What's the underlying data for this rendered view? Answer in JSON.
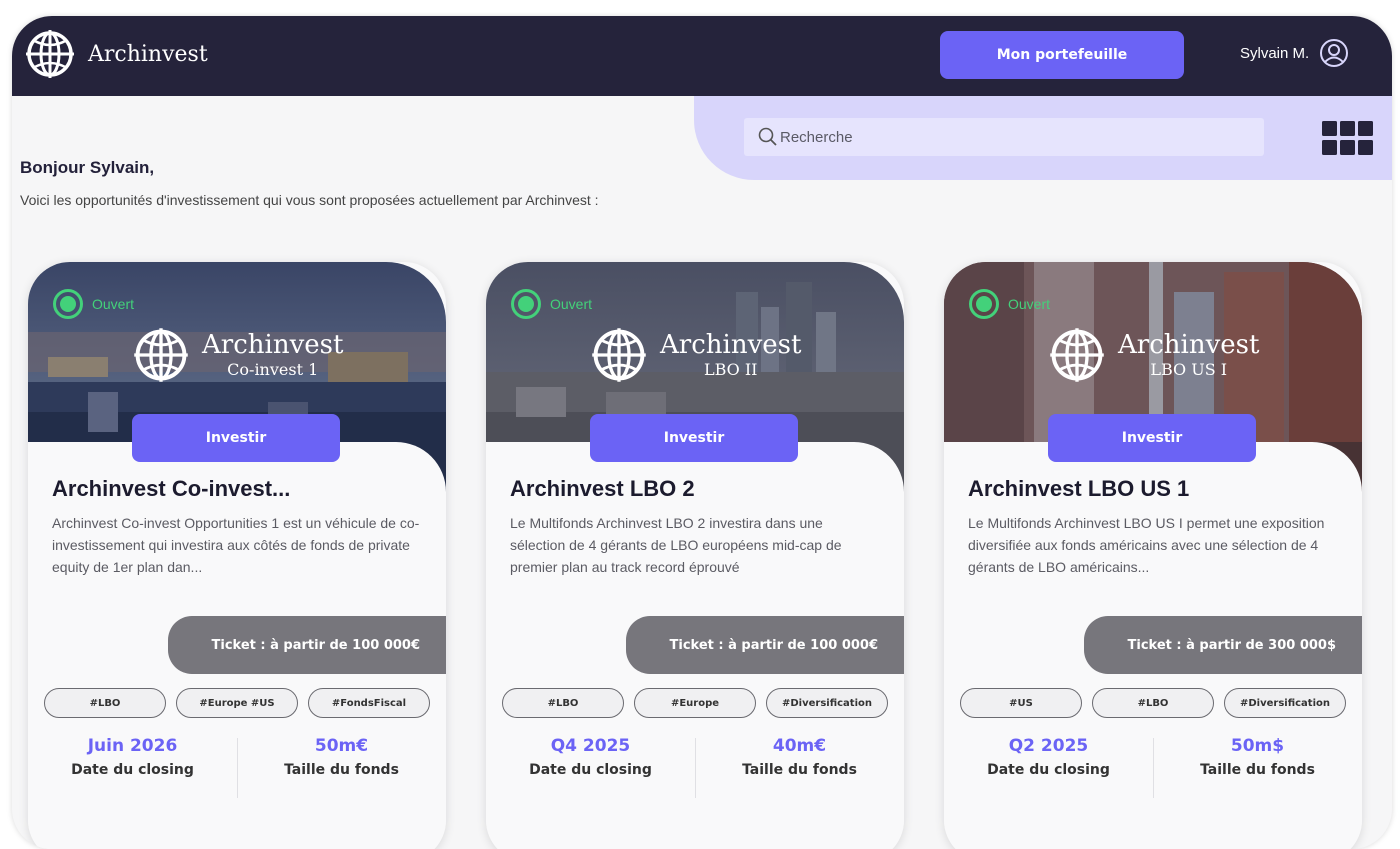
{
  "header": {
    "brand": "Archinvest",
    "portfolio_button": "Mon portefeuille",
    "user_name": "Sylvain M."
  },
  "search": {
    "placeholder": "Recherche"
  },
  "intro": {
    "greeting": "Bonjour Sylvain,",
    "subtitle": "Voici les opportunités d'investissement qui vous sont proposées actuellement par Archinvest :"
  },
  "colors": {
    "primary": "#6b63f5",
    "header_bg": "#25233b",
    "open_status": "#43d17a",
    "ticket_bg": "#77767c"
  },
  "cards": [
    {
      "status": "Ouvert",
      "image_brand": "Archinvest",
      "image_sub": "Co-invest 1",
      "invest_label": "Investir",
      "title": "Archinvest Co-invest...",
      "description": "Archinvest Co-invest Opportunities 1 est un véhicule de co-investissement qui investira aux côtés de fonds de private equity de 1er plan dan...",
      "ticket": "Ticket : à partir de 100 000€",
      "tags": [
        "#LBO",
        "#Europe #US",
        "#FondsFiscal"
      ],
      "closing_value": "Juin 2026",
      "closing_label": "Date du closing",
      "size_value": "50m€",
      "size_label": "Taille du fonds"
    },
    {
      "status": "Ouvert",
      "image_brand": "Archinvest",
      "image_sub": "LBO II",
      "invest_label": "Investir",
      "title": "Archinvest LBO 2",
      "description": "Le Multifonds Archinvest LBO 2 investira dans une sélection de 4 gérants de LBO européens mid-cap de premier plan au track record éprouvé",
      "ticket": "Ticket : à partir de 100 000€",
      "tags": [
        "#LBO",
        "#Europe",
        "#Diversification"
      ],
      "closing_value": "Q4 2025",
      "closing_label": "Date du closing",
      "size_value": "40m€",
      "size_label": "Taille du fonds"
    },
    {
      "status": "Ouvert",
      "image_brand": "Archinvest",
      "image_sub": "LBO US I",
      "invest_label": "Investir",
      "title": "Archinvest LBO US 1",
      "description": "Le Multifonds Archinvest LBO US I permet une exposition diversifiée aux fonds américains avec une sélection de 4 gérants de LBO américains...",
      "ticket": "Ticket : à partir de 300 000$",
      "tags": [
        "#US",
        "#LBO",
        "#Diversification"
      ],
      "closing_value": "Q2 2025",
      "closing_label": "Date du closing",
      "size_value": "50m$",
      "size_label": "Taille du fonds"
    }
  ]
}
